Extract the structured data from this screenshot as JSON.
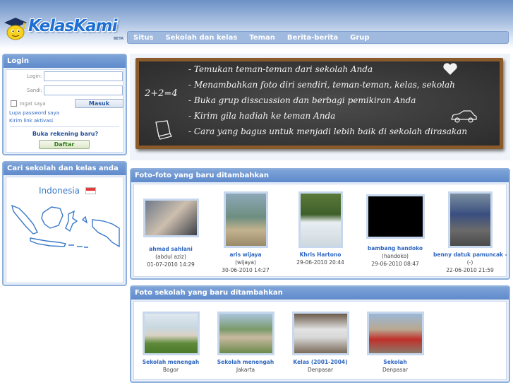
{
  "brand": {
    "name": "KelasKami",
    "beta": "BETA"
  },
  "nav": {
    "items": [
      "Situs",
      "Sekolah dan kelas",
      "Teman",
      "Berita-berita",
      "Grup"
    ]
  },
  "login": {
    "title": "Login",
    "login_label": "Login:",
    "password_label": "Sandi:",
    "remember_label": "Ingat saya",
    "submit_label": "Masuk",
    "forgot_link": "Lupa password saya",
    "activation_link": "Kirim link aktivasi",
    "new_account_text": "Buka rekening baru?",
    "register_label": "Daftar"
  },
  "search": {
    "title": "Cari sekolah dan kelas anda",
    "country": "Indonesia"
  },
  "banner": {
    "equation": "2+2=4",
    "lines": [
      "- Temukan teman-teman dari sekolah Anda",
      "- Menambahkan foto diri sendiri, teman-teman, kelas, sekolah",
      "- Buka grup disscussion dan berbagi pemikiran Anda",
      "- Kirim gila hadiah ke teman Anda",
      "- Cara yang bagus untuk menjadi lebih baik di sekolah dirasakan"
    ]
  },
  "recent_photos": {
    "title": "Foto-foto yang baru ditambahkan",
    "items": [
      {
        "name": "ahmad sahlani",
        "user": "(abdul aziz)",
        "date": "01-07-2010 14:29"
      },
      {
        "name": "aris wijaya",
        "user": "(wijaya)",
        "date": "30-06-2010 14:27"
      },
      {
        "name": "Khris Hartono",
        "user": "",
        "date": "29-06-2010 20:44"
      },
      {
        "name": "bambang handoko",
        "user": "(handoko)",
        "date": "29-06-2010 08:47"
      },
      {
        "name": "benny datuk pamuncak -",
        "user": "(-)",
        "date": "22-06-2010 21:59"
      }
    ]
  },
  "recent_schools": {
    "title": "Foto sekolah yang baru ditambahkan",
    "items": [
      {
        "name": "Sekolah menengah",
        "city": "Bogor"
      },
      {
        "name": "Sekolah menengah",
        "city": "Jakarta"
      },
      {
        "name": "Kelas (2001-2004)",
        "city": "Denpasar"
      },
      {
        "name": "Sekolah",
        "city": "Denpasar"
      }
    ]
  }
}
